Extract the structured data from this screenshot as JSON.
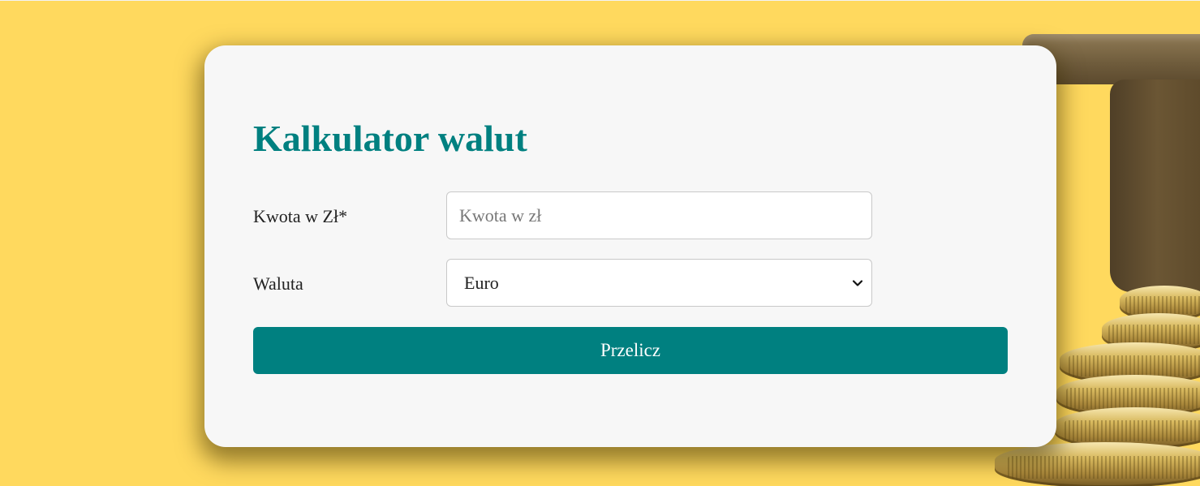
{
  "calculator": {
    "title": "Kalkulator walut",
    "amount_label": "Kwota w Zł*",
    "amount_placeholder": "Kwota w zł",
    "amount_value": "",
    "currency_label": "Waluta",
    "currency_selected": "Euro",
    "submit_label": "Przelicz"
  },
  "colors": {
    "accent": "#008080",
    "background": "#ffd95e",
    "card": "#f7f7f7"
  },
  "icons": {
    "select_arrow": "chevron-down-icon",
    "background_image": "coins-graduation-cap"
  }
}
